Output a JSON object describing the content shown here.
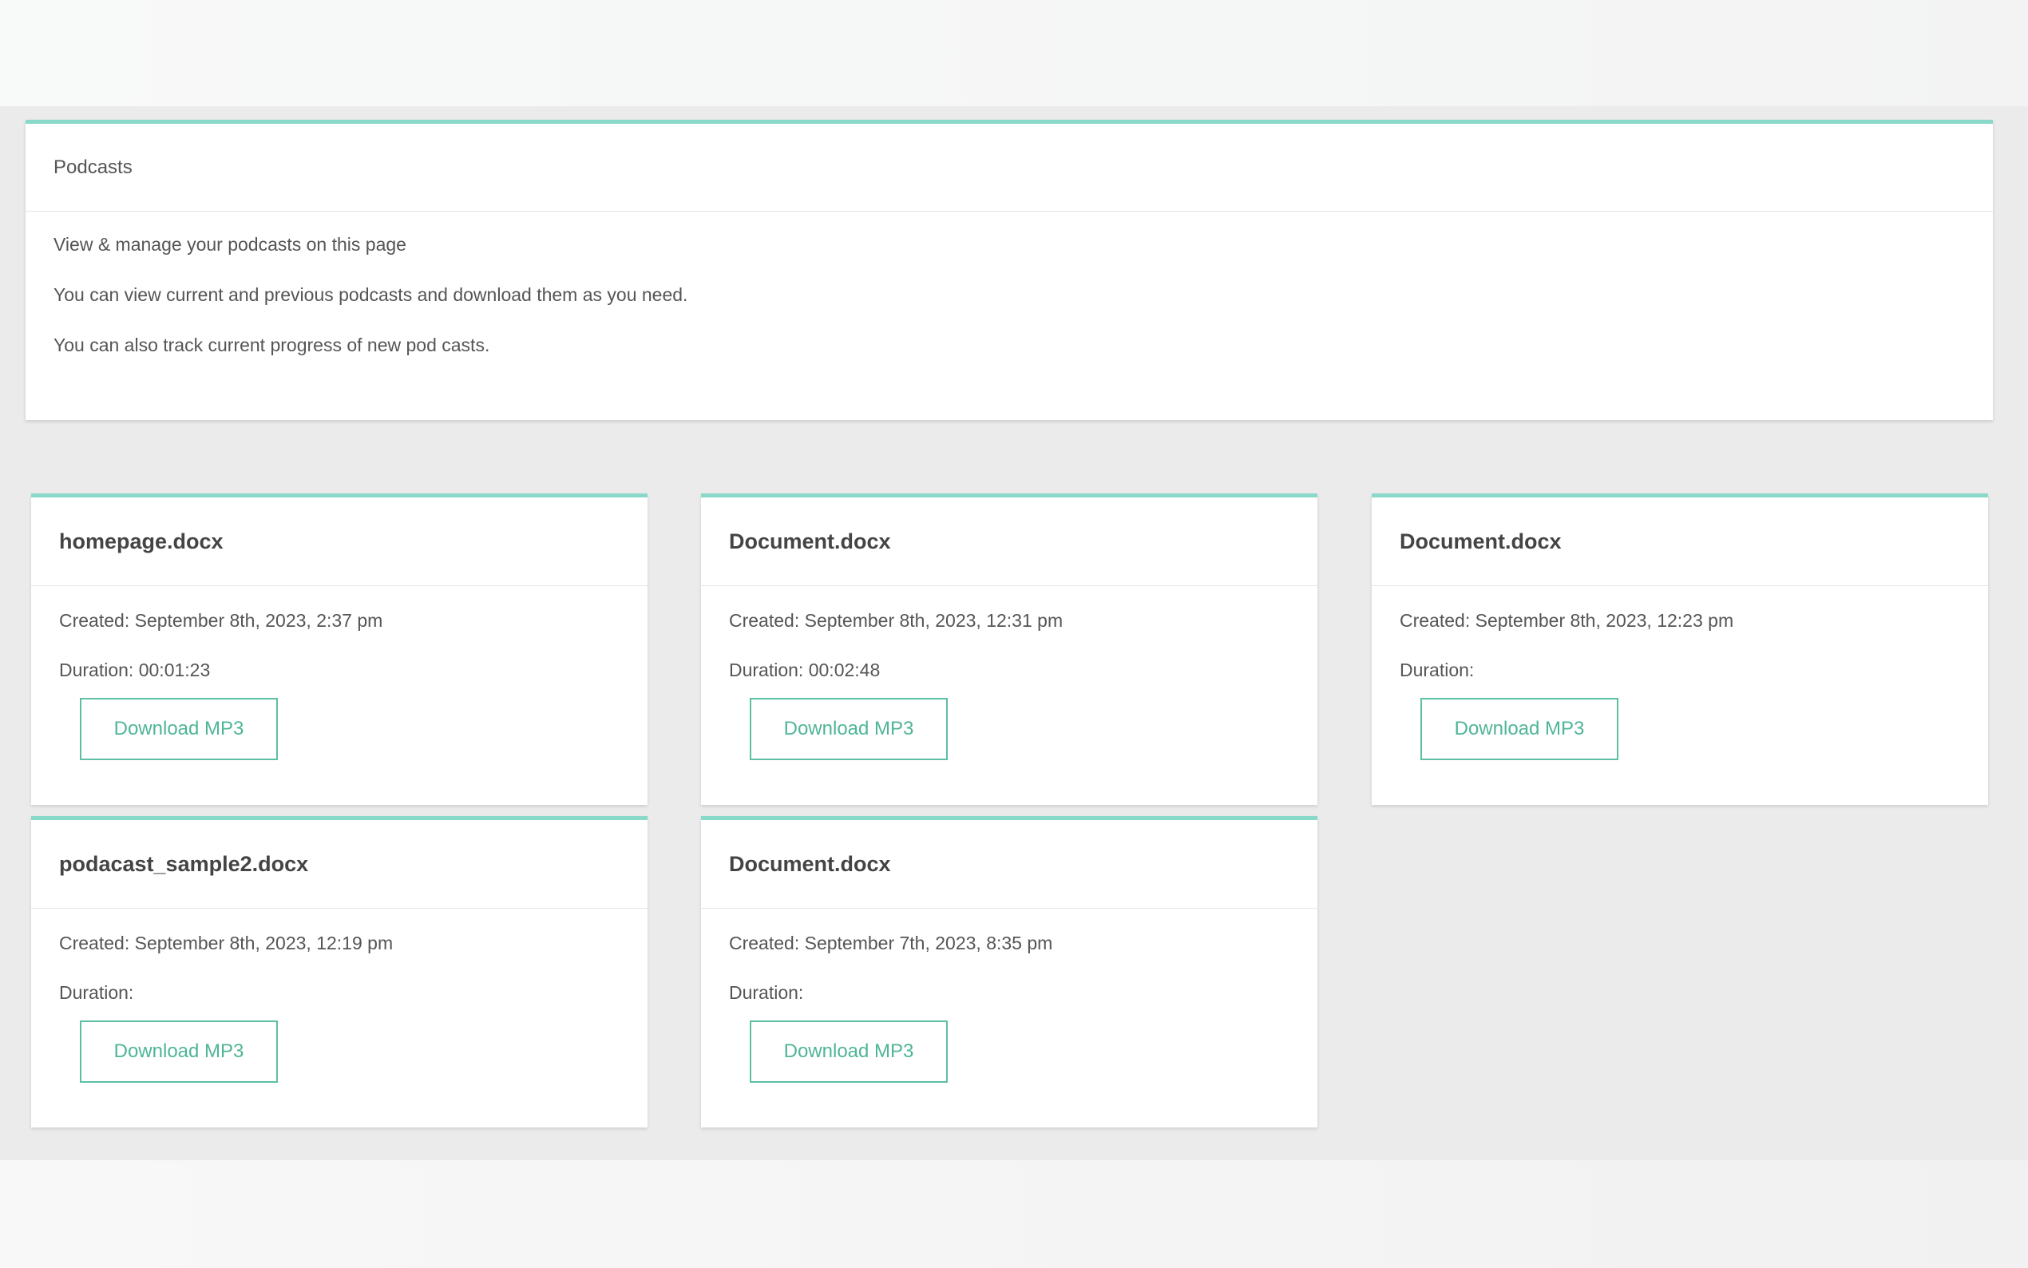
{
  "intro": {
    "title": "Podcasts",
    "lines": [
      "View & manage your podcasts on this page",
      "You can view current and previous podcasts and download them as you need.",
      "You can also track current progress of new pod casts."
    ]
  },
  "podcasts": [
    {
      "filename": "homepage.docx",
      "created": "Created: September 8th, 2023, 2:37 pm",
      "duration": "Duration: 00:01:23",
      "button": "Download MP3"
    },
    {
      "filename": "Document.docx",
      "created": "Created: September 8th, 2023, 12:31 pm",
      "duration": "Duration: 00:02:48",
      "button": "Download MP3"
    },
    {
      "filename": "Document.docx",
      "created": "Created: September 8th, 2023, 12:23 pm",
      "duration": "Duration:",
      "button": "Download MP3"
    },
    {
      "filename": "podacast_sample2.docx",
      "created": "Created: September 8th, 2023, 12:19 pm",
      "duration": "Duration:",
      "button": "Download MP3"
    },
    {
      "filename": "Document.docx",
      "created": "Created: September 7th, 2023, 8:35 pm",
      "duration": "Duration:",
      "button": "Download MP3"
    }
  ],
  "colors": {
    "accent": "#88d9c9",
    "button_border": "#5cbfa5",
    "button_text": "#4fb597",
    "background": "#ebebeb"
  }
}
